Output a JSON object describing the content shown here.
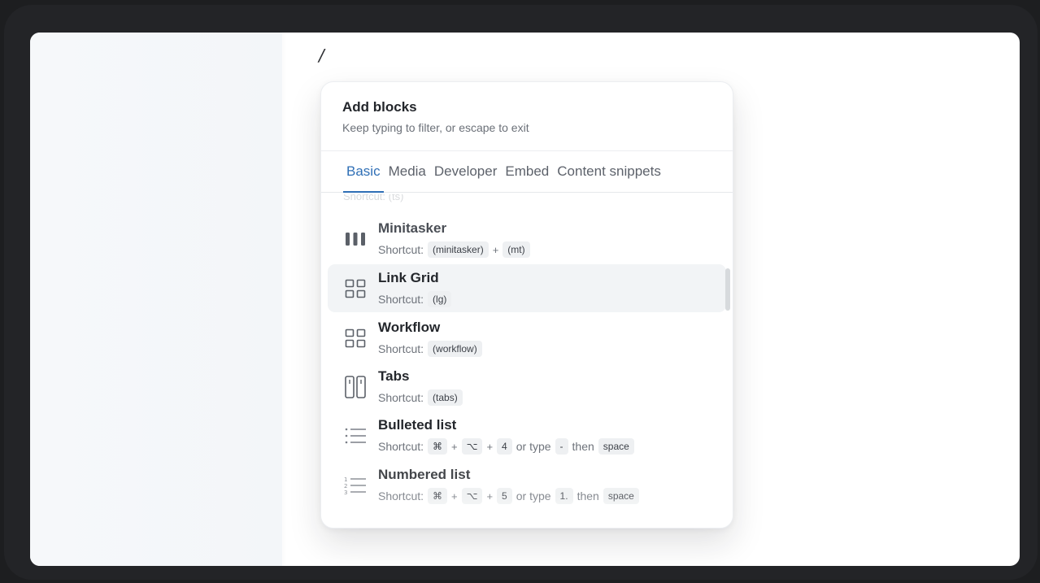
{
  "editor": {
    "slash_text": "/"
  },
  "menu": {
    "title": "Add blocks",
    "subtitle": "Keep typing to filter, or escape to exit",
    "tabs": [
      {
        "label": "Basic",
        "active": true
      },
      {
        "label": "Media",
        "active": false
      },
      {
        "label": "Developer",
        "active": false
      },
      {
        "label": "Embed",
        "active": false
      },
      {
        "label": "Content snippets",
        "active": false
      }
    ],
    "partial_item_text": "Shortcut: (ts)",
    "shortcut_label": "Shortcut:",
    "items": [
      {
        "name": "Minitasker",
        "icon": "columns-bars-icon",
        "keys": [
          "(minitasker)",
          "+",
          "(mt)"
        ]
      },
      {
        "name": "Link Grid",
        "icon": "grid-icon",
        "keys": [
          "(lg)"
        ]
      },
      {
        "name": "Workflow",
        "icon": "grid-icon",
        "keys": [
          "(workflow)"
        ]
      },
      {
        "name": "Tabs",
        "icon": "tabs-icon",
        "keys": [
          "(tabs)"
        ]
      },
      {
        "name": "Bulleted list",
        "icon": "bulleted-list-icon",
        "keys": [
          "⌘",
          "+",
          "⌥",
          "+",
          "4",
          "or type",
          "-",
          "then",
          "space"
        ]
      },
      {
        "name": "Numbered list",
        "icon": "numbered-list-icon",
        "keys": [
          "⌘",
          "+",
          "⌥",
          "+",
          "5",
          "or type",
          "1.",
          "then",
          "space"
        ]
      }
    ]
  },
  "colors": {
    "accent": "#2f6fb6",
    "hover_row": "#f2f4f6",
    "background": "#1d1e20"
  }
}
